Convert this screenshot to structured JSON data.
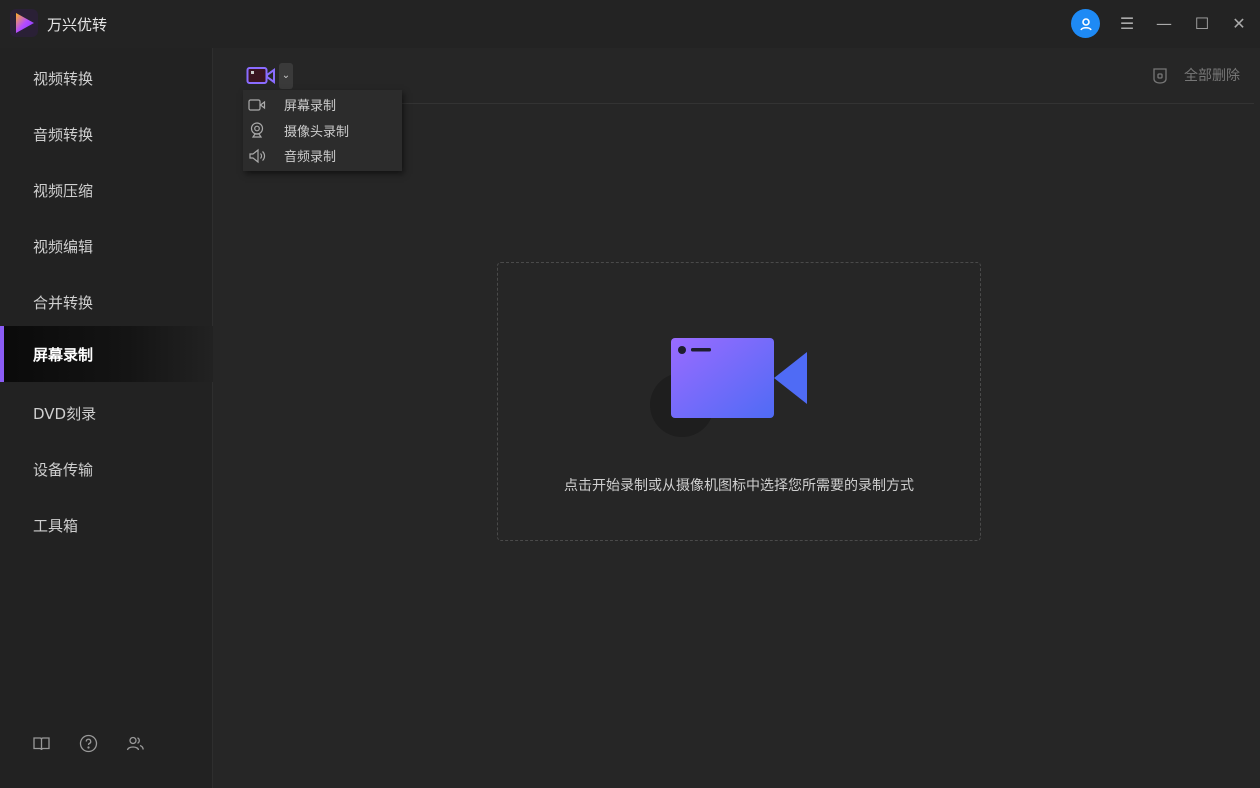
{
  "app": {
    "title": "万兴优转"
  },
  "sidebar": {
    "items": [
      {
        "label": "视频转换"
      },
      {
        "label": "音频转换"
      },
      {
        "label": "视频压缩"
      },
      {
        "label": "视频编辑"
      },
      {
        "label": "合并转换"
      },
      {
        "label": "屏幕录制",
        "active": true
      },
      {
        "label": "DVD刻录"
      },
      {
        "label": "设备传输"
      },
      {
        "label": "工具箱"
      }
    ]
  },
  "record_menu": {
    "items": [
      {
        "label": "屏幕录制",
        "icon": "camera-icon"
      },
      {
        "label": "摄像头录制",
        "icon": "webcam-icon"
      },
      {
        "label": "音频录制",
        "icon": "speaker-icon"
      }
    ]
  },
  "toolbar": {
    "clear_all": "全部删除"
  },
  "main": {
    "hint": "点击开始录制或从摄像机图标中选择您所需要的录制方式"
  },
  "colors": {
    "accent": "#8b5cf6",
    "avatar": "#1e8af5",
    "background": "#262626"
  }
}
